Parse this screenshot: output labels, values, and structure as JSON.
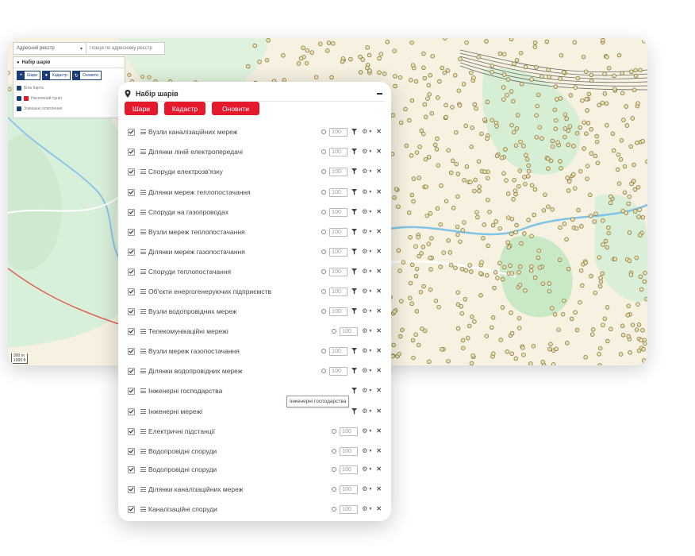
{
  "map": {
    "search_select_label": "Адресний реєстр",
    "search_placeholder": "Пошук по адресному реєстр",
    "mini_panel_title": "Набір шарів",
    "mini_buttons": [
      "Шари",
      "Кадастр",
      "Оновити"
    ],
    "mini_layers": [
      "Біла Карта",
      "Населений пункт",
      "Зовнішнє освітлення"
    ],
    "scale_text_1": "300 m",
    "scale_text_2": "1000 ft"
  },
  "panel": {
    "title": "Набір шарів",
    "buttons": {
      "layers": "Шари",
      "cadastre": "Кадастр",
      "refresh": "Оновити"
    },
    "colors": {
      "button_red": "#e5192c",
      "mini_blue": "#1a3d7a"
    },
    "layers": [
      {
        "name": "Вузли каналізаційних мереж",
        "opacity": "100",
        "radio": true,
        "filter": true
      },
      {
        "name": "Ділянки ліній електропередачі",
        "opacity": "100",
        "radio": true,
        "filter": true
      },
      {
        "name": "Споруди електрозв'язку",
        "opacity": "100",
        "radio": true,
        "filter": true
      },
      {
        "name": "Ділянки мереж теплопостачання",
        "opacity": "100",
        "radio": true,
        "filter": true
      },
      {
        "name": "Споруди на газопроводах",
        "opacity": "100",
        "radio": true,
        "filter": true
      },
      {
        "name": "Вузли мереж теплопостачання",
        "opacity": "100",
        "radio": true,
        "filter": true
      },
      {
        "name": "Ділянки мереж газопостачання",
        "opacity": "100",
        "radio": true,
        "filter": true
      },
      {
        "name": "Споруди теплопостачання",
        "opacity": "100",
        "radio": true,
        "filter": true
      },
      {
        "name": "Об'єкти енергогенеруючих підприємств",
        "opacity": "100",
        "radio": true,
        "filter": true
      },
      {
        "name": "Вузли водопровідних мереж",
        "opacity": "100",
        "radio": true,
        "filter": true
      },
      {
        "name": "Телекомунікаційні мережі",
        "opacity": "100",
        "radio": true,
        "filter": false
      },
      {
        "name": "Вузли мереж газопостачання",
        "opacity": "100",
        "radio": true,
        "filter": true
      },
      {
        "name": "Ділянки водопровідних мереж",
        "opacity": "100",
        "radio": true,
        "filter": true
      },
      {
        "name": "Інженерні господарства",
        "opacity": "",
        "radio": false,
        "filter": true
      },
      {
        "name": "Інженерні мережі",
        "opacity": "",
        "radio": false,
        "filter": true
      },
      {
        "name": "Електричні підстанції",
        "opacity": "100",
        "radio": true,
        "filter": false
      },
      {
        "name": "Водопровідні споруди",
        "opacity": "100",
        "radio": true,
        "filter": false
      },
      {
        "name": "Водопровідні споруди",
        "opacity": "100",
        "radio": true,
        "filter": false
      },
      {
        "name": "Ділянки каналізаційних мереж",
        "opacity": "100",
        "radio": true,
        "filter": false
      },
      {
        "name": "Каналізаційні споруди",
        "opacity": "100",
        "radio": true,
        "filter": false
      }
    ],
    "tooltip": "Інженерні господарства"
  }
}
